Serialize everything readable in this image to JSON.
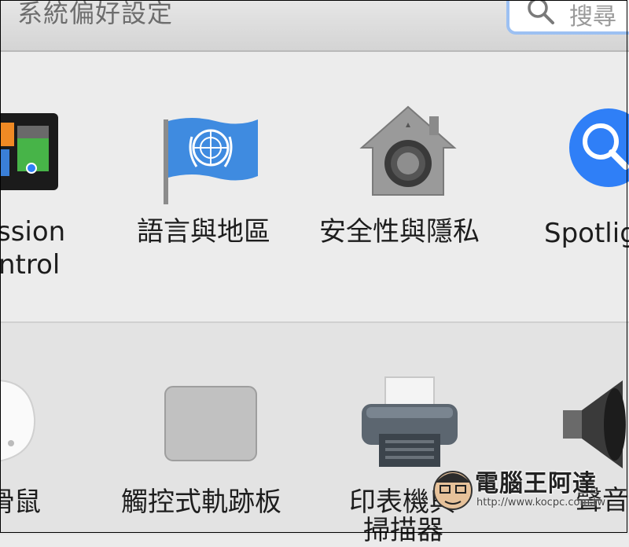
{
  "window": {
    "title": "系統偏好設定"
  },
  "search": {
    "placeholder": "搜尋"
  },
  "row1": {
    "mission_control": {
      "line1": "ssion",
      "line2": "ntrol"
    },
    "language_region": {
      "label": "語言與地區"
    },
    "security_privacy": {
      "label": "安全性與隱私"
    },
    "spotlight": {
      "label": "Spotlig"
    }
  },
  "row2": {
    "mouse": {
      "label": "滑鼠"
    },
    "trackpad": {
      "label": "觸控式軌跡板"
    },
    "printers": {
      "line1": "印表機與",
      "line2": "掃描器"
    },
    "sound": {
      "label": "聲音"
    }
  },
  "watermark": {
    "title": "電腦王阿達",
    "url": "http://www.kocpc.com.tw"
  },
  "colors": {
    "accent": "#2f7ff7",
    "search_ring": "#9cc0f2"
  }
}
